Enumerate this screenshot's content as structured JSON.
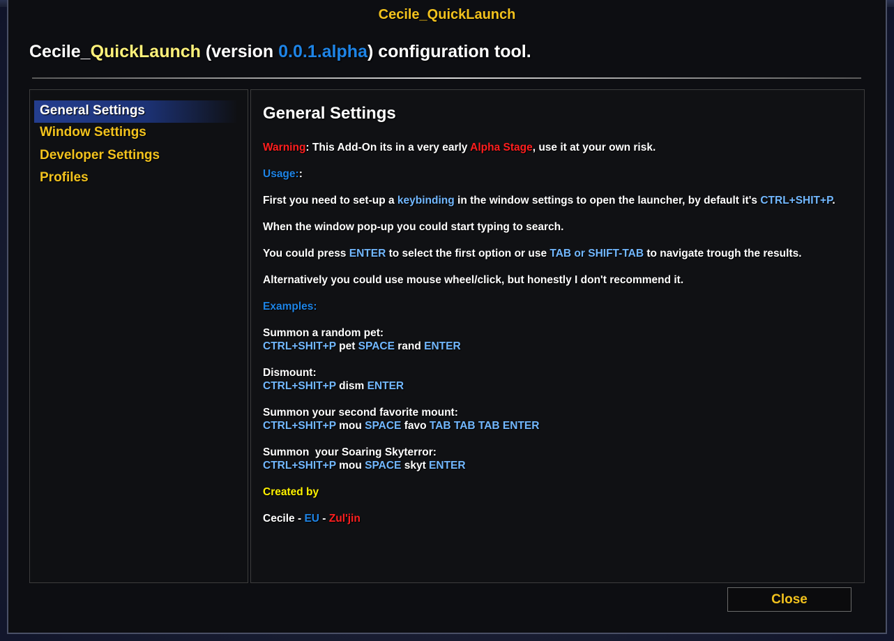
{
  "window": {
    "title": "Cecile_QuickLaunch"
  },
  "header": {
    "prefix": "Cecile_",
    "addon_name": "QuickLaunch",
    "version_open": " (version ",
    "version": "0.0.1.alpha",
    "suffix": ") configuration tool."
  },
  "sidebar": {
    "items": [
      {
        "label": "General Settings",
        "selected": true
      },
      {
        "label": "Window Settings",
        "selected": false
      },
      {
        "label": "Developer Settings",
        "selected": false
      },
      {
        "label": "Profiles",
        "selected": false
      }
    ]
  },
  "content": {
    "title": "General Settings",
    "warning": {
      "label": "Warning",
      "text1": ": This Add-On its in a very early ",
      "stage": "Alpha Stage",
      "text2": ", use it at your own risk."
    },
    "usage": {
      "label": "Usage:",
      "colon": ":"
    },
    "line1": {
      "t1": "First you need to set-up a ",
      "k1": "keybinding",
      "t2": " in the window settings to open the launcher, by default it's ",
      "k2": "CTRL+SHIT+P",
      "t3": "."
    },
    "line2": "When the window pop-up you could start typing to search.",
    "line3": {
      "t1": "You could press ",
      "k1": "ENTER",
      "t2": " to select the first option or use ",
      "k2": "TAB or SHIFT-TAB",
      "t3": " to navigate trough the results."
    },
    "line4": "Alternatively you could use mouse wheel/click, but honestly I don't recommend it.",
    "examples_label": "Examples:",
    "ex1": {
      "title": "Summon a random pet:",
      "k1": "CTRL+SHIT+P",
      "t1": " pet ",
      "k2": "SPACE",
      "t2": " rand ",
      "k3": "ENTER"
    },
    "ex2": {
      "title": "Dismount:",
      "k1": "CTRL+SHIT+P",
      "t1": " dism ",
      "k2": "ENTER"
    },
    "ex3": {
      "title": "Summon your second favorite mount:",
      "k1": "CTRL+SHIT+P",
      "t1": " mou ",
      "k2": "SPACE",
      "t2": " favo ",
      "k3": "TAB TAB TAB ENTER"
    },
    "ex4": {
      "title": "Summon  your Soaring Skyterror:",
      "k1": "CTRL+SHIT+P",
      "t1": " mou ",
      "k2": "SPACE",
      "t2": " skyt ",
      "k3": "ENTER"
    },
    "created_by": "Created by",
    "author": {
      "name": "Cecile",
      "sep1": " - ",
      "region": "EU",
      "sep2": " - ",
      "realm": "Zul'jin"
    }
  },
  "footer": {
    "close_label": "Close"
  },
  "colors": {
    "gold": "#f2c21d",
    "light_blue": "#72b8ff",
    "blue": "#1e84e6",
    "red": "#ff1f1f",
    "selection": "#243e8f"
  }
}
